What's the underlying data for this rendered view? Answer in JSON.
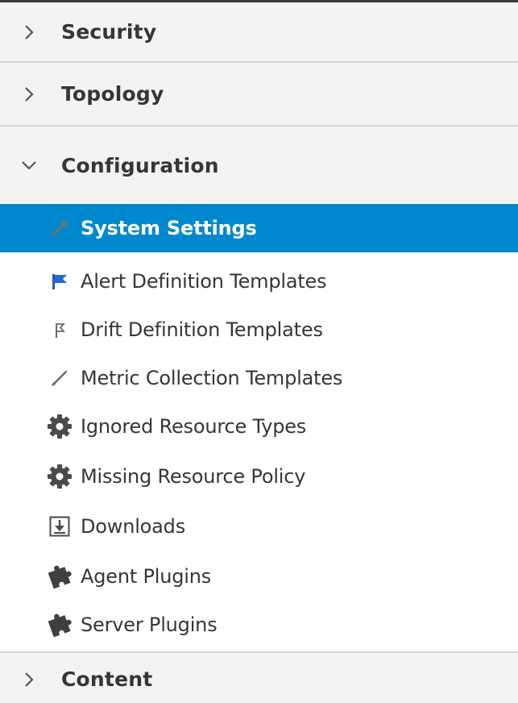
{
  "sections": {
    "security": {
      "label": "Security",
      "expanded": false
    },
    "topology": {
      "label": "Topology",
      "expanded": false
    },
    "configuration": {
      "label": "Configuration",
      "expanded": true,
      "items": [
        {
          "label": "System Settings",
          "icon": "wrench-icon",
          "selected": true
        },
        {
          "label": "Alert Definition Templates",
          "icon": "flag-icon",
          "selected": false
        },
        {
          "label": "Drift Definition Templates",
          "icon": "drift-flag-icon",
          "selected": false
        },
        {
          "label": "Metric Collection Templates",
          "icon": "pencil-icon",
          "selected": false
        },
        {
          "label": "Ignored Resource Types",
          "icon": "gear-icon",
          "selected": false
        },
        {
          "label": "Missing Resource Policy",
          "icon": "gear-icon",
          "selected": false
        },
        {
          "label": "Downloads",
          "icon": "download-icon",
          "selected": false
        },
        {
          "label": "Agent Plugins",
          "icon": "puzzle-icon",
          "selected": false
        },
        {
          "label": "Server Plugins",
          "icon": "puzzle-icon",
          "selected": false
        }
      ]
    },
    "content": {
      "label": "Content",
      "expanded": false
    }
  },
  "colors": {
    "selected_background": "#0088ce",
    "header_background": "#f3f3f3",
    "text": "#363636",
    "flag_blue": "#0088ce"
  }
}
